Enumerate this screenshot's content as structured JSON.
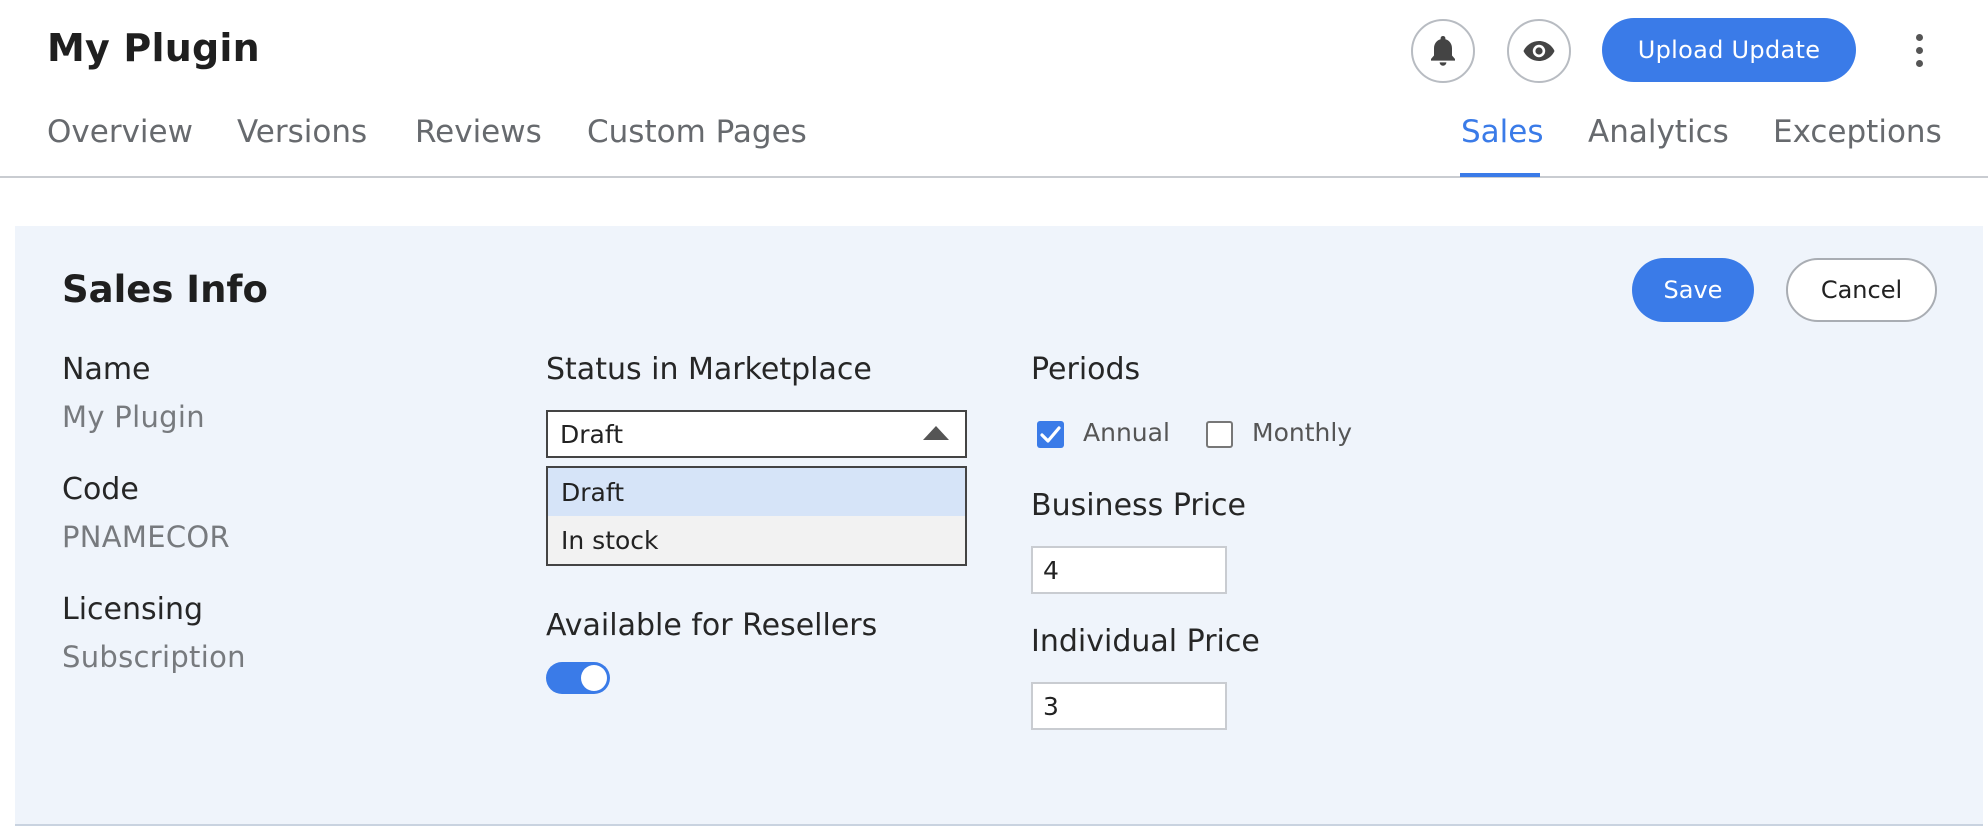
{
  "header": {
    "title": "My Plugin",
    "upload_label": "Upload Update",
    "icons": {
      "notifications": "bell-icon",
      "preview": "eye-icon",
      "more": "kebab-menu-icon"
    }
  },
  "tabs": [
    {
      "label": "Overview",
      "active": false
    },
    {
      "label": "Versions",
      "active": false
    },
    {
      "label": "Reviews",
      "active": false
    },
    {
      "label": "Custom Pages",
      "active": false
    },
    {
      "label": "Sales",
      "active": true
    },
    {
      "label": "Analytics",
      "active": false
    },
    {
      "label": "Exceptions",
      "active": false
    }
  ],
  "sales_info": {
    "title": "Sales Info",
    "save_label": "Save",
    "cancel_label": "Cancel",
    "name": {
      "label": "Name",
      "value": "My Plugin"
    },
    "code": {
      "label": "Code",
      "value": "PNAMECOR"
    },
    "licensing": {
      "label": "Licensing",
      "value": "Subscription"
    },
    "status": {
      "label": "Status in Marketplace",
      "selected": "Draft",
      "options": [
        "Draft",
        "In stock"
      ]
    },
    "resellers": {
      "label": "Available for Resellers",
      "enabled": true
    },
    "periods": {
      "label": "Periods",
      "options": [
        {
          "label": "Annual",
          "checked": true
        },
        {
          "label": "Monthly",
          "checked": false
        }
      ]
    },
    "business_price": {
      "label": "Business Price",
      "value": "4"
    },
    "individual_price": {
      "label": "Individual Price",
      "value": "3"
    }
  },
  "colors": {
    "accent": "#3a7be8",
    "panel_bg": "#eff4fb",
    "selected_option": "#d6e4f8"
  }
}
